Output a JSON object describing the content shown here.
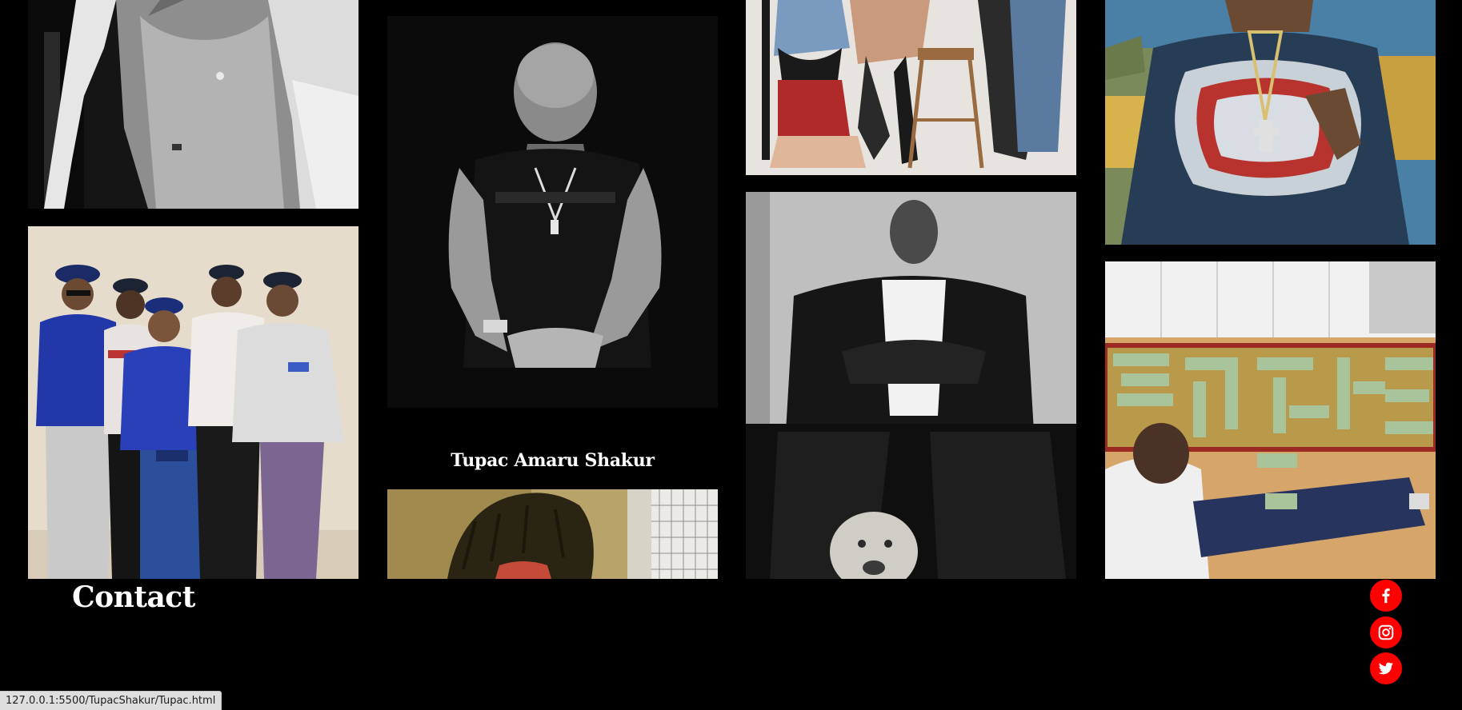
{
  "page": {
    "background_color": "#000000"
  },
  "gallery": {
    "tiles": [
      {
        "subject": "hoodie portrait (black and white)"
      },
      {
        "subject": "group of five in caps and sweatshirts"
      },
      {
        "subject": "Tupac portrait (black and white)",
        "caption": "Tupac Amaru Shakur"
      },
      {
        "subject": "dreadlocks portrait (cropped)"
      },
      {
        "subject": "group posing on stool (cropped)"
      },
      {
        "subject": "man seated with dog (black and white)"
      },
      {
        "subject": "Yankees jersey with chain"
      },
      {
        "subject": "man sitting by cash spelled on rug"
      }
    ]
  },
  "contact": {
    "title": "Contact",
    "links": [
      {
        "icon": "facebook-icon",
        "color": "#ff0000"
      },
      {
        "icon": "instagram-icon",
        "color": "#ff0000"
      },
      {
        "icon": "twitter-icon",
        "color": "#ff0000"
      }
    ]
  },
  "status_bar": {
    "url": "127.0.0.1:5500/TupacShakur/Tupac.html"
  }
}
